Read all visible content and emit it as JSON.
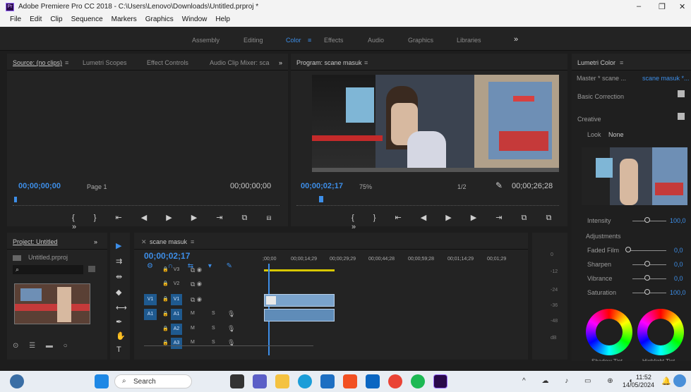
{
  "titlebar": {
    "app_title": "Adobe Premiere Pro CC 2018 - C:\\Users\\Lenovo\\Downloads\\Untitled.prproj *",
    "minimize": "–",
    "restore": "❐",
    "close": "✕"
  },
  "menu": [
    "File",
    "Edit",
    "Clip",
    "Sequence",
    "Markers",
    "Graphics",
    "Window",
    "Help"
  ],
  "workspaces": {
    "items": [
      "Assembly",
      "Editing",
      "Color",
      "Effects",
      "Audio",
      "Graphics",
      "Libraries"
    ],
    "active": "Color",
    "more": "»"
  },
  "source": {
    "tabs": [
      "Source: (no clips)",
      "Lumetri Scopes",
      "Effect Controls",
      "Audio Clip Mixer: sca"
    ],
    "more": "»",
    "timecode_in": "00;00;00;00",
    "page": "Page 1",
    "timecode_out": "00;00;00;00"
  },
  "program": {
    "tab": "Program: scane masuk",
    "timecode": "00;00;02;17",
    "zoom": "75%",
    "quality": "1/2",
    "duration": "00;00;26;28"
  },
  "lumetri": {
    "tab": "Lumetri Color",
    "master": "Master * scane ...",
    "clip": "scane masuk *...",
    "basic": "Basic Correction",
    "creative": "Creative",
    "look_label": "Look",
    "look_value": "None",
    "intensity_label": "Intensity",
    "intensity_value": "100,0",
    "adjustments": "Adjustments",
    "rows": [
      {
        "label": "Faded Film",
        "value": "0,0"
      },
      {
        "label": "Sharpen",
        "value": "0,0"
      },
      {
        "label": "Vibrance",
        "value": "0,0"
      },
      {
        "label": "Saturation",
        "value": "100,0"
      }
    ],
    "wheel1": "Shadow Tint",
    "wheel2": "Highlight Tint"
  },
  "project": {
    "tab": "Project: Untitled",
    "more": "»",
    "file": "Untitled.prproj",
    "search_icon": "magnifier"
  },
  "timeline": {
    "tab": "scane masuk",
    "timecode": "00;00;02;17",
    "ruler": [
      ";00;00",
      "00;00;14;29",
      "00;00;29;29",
      "00;00;44;28",
      "00;00;59;28",
      "00;01;14;29",
      "00;01;29"
    ],
    "tracks": [
      "V3",
      "V2",
      "V1",
      "A1",
      "A2",
      "A3"
    ],
    "m": "M",
    "s": "S"
  },
  "meter": {
    "labels": [
      "0",
      "-12",
      "-24",
      "-36",
      "-48",
      "dB"
    ]
  },
  "taskbar": {
    "search": "Search",
    "time": "11:52",
    "date": "14/05/2024"
  }
}
